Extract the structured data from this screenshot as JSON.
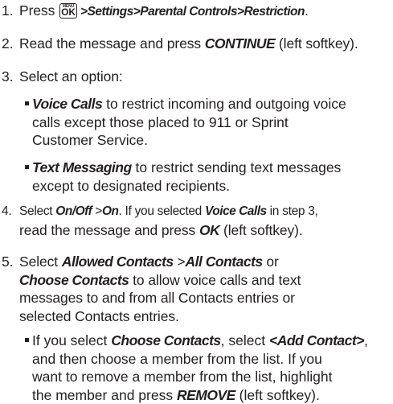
{
  "step1": {
    "num": "1.",
    "press": "Press",
    "key_top": "MENU",
    "key_bottom": "OK",
    "path": ">Settings>Parental Controls>Restriction",
    "end": "."
  },
  "step2": {
    "num": "2.",
    "pre": "Read the message and press ",
    "bold": "CONTINUE",
    "post": " (left softkey)."
  },
  "step3": {
    "num": "3.",
    "text": "Select an option:",
    "opt1": {
      "bold": "Voice Calls",
      "l1": " to restrict incoming and outgoing voice",
      "l2": "calls except those placed to 911 or Sprint",
      "l3": "Customer Service."
    },
    "opt2": {
      "bold": "Text Messaging",
      "l1": " to restrict sending text messages",
      "l2": "except to designated recipients."
    }
  },
  "step4": {
    "num": "4.",
    "pre": "Select ",
    "b1": "On/Off",
    "gt": " >",
    "b2": "On",
    "mid": ". If you selected ",
    "b3": "Voice Calls",
    "post": " in step 3,",
    "l2pre": "read the message and press ",
    "b4": "OK",
    "l2post": " (left softkey)."
  },
  "step5": {
    "num": "5.",
    "pre": "Select ",
    "b1": "Allowed Contacts",
    "gt": " >",
    "b2": "All Contacts",
    "or": " or",
    "b3": "Choose Contacts",
    "l2post": " to allow voice calls and text",
    "l3": "messages to and from all Contacts entries or",
    "l4": "selected Contacts entries.",
    "sub": {
      "pre": "If you select ",
      "b1": "Choose Contacts",
      "mid": ", select ",
      "b2": "<Add Contact>",
      "end": ",",
      "l2": "and then choose a member from the list. If you",
      "l3": "want to remove a member from the list, highlight",
      "l4pre": "the member and press ",
      "b3": "REMOVE",
      "l4post": " (left softkey)."
    }
  }
}
